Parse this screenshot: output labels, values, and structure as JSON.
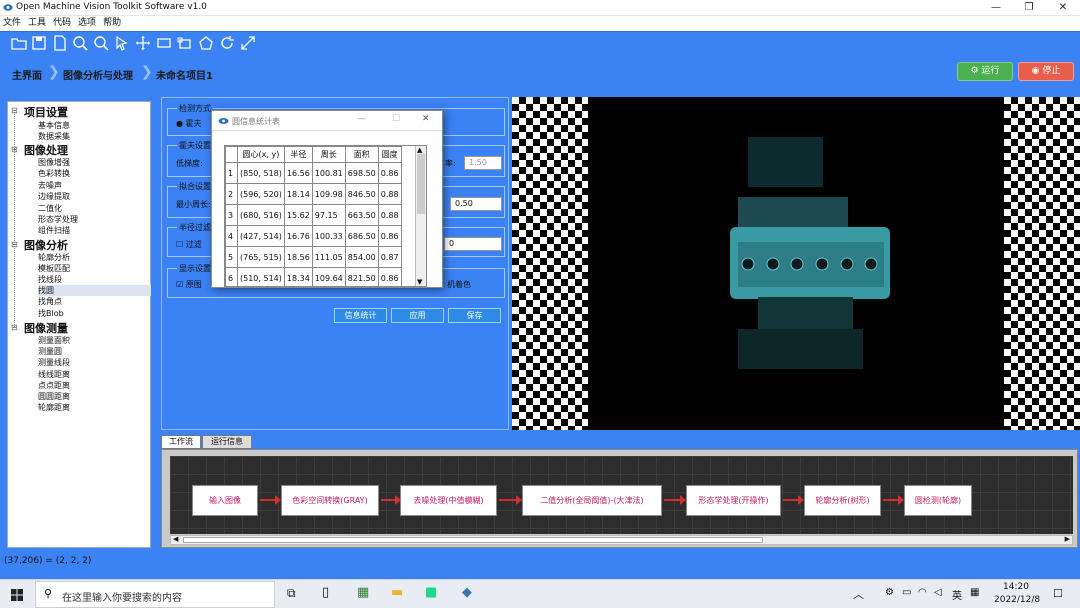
{
  "window": {
    "title": "Open Machine Vision Toolkit Software v1.0",
    "minimize": "—",
    "maximize": "❐",
    "close": "✕"
  },
  "menu": [
    "文件",
    "工具",
    "代码",
    "选项",
    "帮助"
  ],
  "toolbar_icons": [
    "open-folder-icon",
    "save-icon",
    "new-file-icon",
    "zoom-in-icon",
    "zoom-out-icon",
    "pointer-icon",
    "move-icon",
    "rectangle-icon",
    "crop-icon",
    "polygon-icon",
    "rotate-icon",
    "fit-icon"
  ],
  "breadcrumb": {
    "home": "主界面",
    "section": "图像分析与处理",
    "project": "未命名项目1"
  },
  "actions": {
    "run": "运行",
    "stop": "停止"
  },
  "tree": {
    "groups": [
      {
        "label": "项目设置",
        "items": [
          "基本信息",
          "数据采集"
        ]
      },
      {
        "label": "图像处理",
        "items": [
          "图像增强",
          "色彩转换",
          "去噪声",
          "边缘提取",
          "二值化",
          "形态学处理",
          "组件扫描"
        ]
      },
      {
        "label": "图像分析",
        "items": [
          "轮廓分析",
          "模板匹配",
          "找线段",
          "找圆",
          "找角点",
          "找Blob"
        ]
      },
      {
        "label": "图像测量",
        "items": [
          "测量面积",
          "测量圆",
          "测量线段",
          "线线距离",
          "点点距离",
          "圆圆距离",
          "轮廓距离"
        ]
      }
    ],
    "selected": "找圆"
  },
  "settings": {
    "detect_mode": "检测方式",
    "mode_radio": "霍夫",
    "hough_title": "霍夫设置",
    "low_threshold": "低梯度:",
    "ratio_label": "率:",
    "ratio_value": "1.50",
    "fit_title": "拟合设置",
    "min_perimeter": "最小周长:",
    "fit_value": "0.50",
    "radius_filter": "半径过滤",
    "filter_check": "过滤",
    "radius_value": "0",
    "display_title": "显示设置",
    "original_check": "原图",
    "random_color": "机着色",
    "btn_stats": "信息统计",
    "btn_apply": "应用",
    "btn_save": "保存"
  },
  "dialog": {
    "title": "圆信息统计表",
    "headers": [
      "圆心(x, y)",
      "半径",
      "周长",
      "面积",
      "圆度"
    ],
    "rows": [
      {
        "id": "1",
        "center": "(850, 518)",
        "radius": "16.56",
        "perimeter": "100.81",
        "area": "698.50",
        "roundness": "0.86"
      },
      {
        "id": "2",
        "center": "(596, 520)",
        "radius": "18.14",
        "perimeter": "109.98",
        "area": "846.50",
        "roundness": "0.88"
      },
      {
        "id": "3",
        "center": "(680, 516)",
        "radius": "15.62",
        "perimeter": "97.15",
        "area": "663.50",
        "roundness": "0.88"
      },
      {
        "id": "4",
        "center": "(427, 514)",
        "radius": "16.76",
        "perimeter": "100.33",
        "area": "686.50",
        "roundness": "0.86"
      },
      {
        "id": "5",
        "center": "(765, 515)",
        "radius": "18.56",
        "perimeter": "111.05",
        "area": "854.00",
        "roundness": "0.87"
      },
      {
        "id": "6",
        "center": "(510, 514)",
        "radius": "18.34",
        "perimeter": "109.64",
        "area": "821.50",
        "roundness": "0.86"
      }
    ]
  },
  "tabs": [
    "工作流",
    "运行信息"
  ],
  "workflow": [
    "输入图像",
    "色彩空间转换(GRAY)",
    "去噪处理(中值模糊)",
    "二值分析(全局阈值)-(大津法)",
    "形态学处理(开操作)",
    "轮廓分析(树形)",
    "圆检测(轮廓)"
  ],
  "status": "(37,206) = (2, 2, 2)",
  "taskbar": {
    "search_placeholder": "在这里输入你要搜索的内容",
    "lang": "英",
    "time": "14:20",
    "date": "2022/12/8"
  }
}
